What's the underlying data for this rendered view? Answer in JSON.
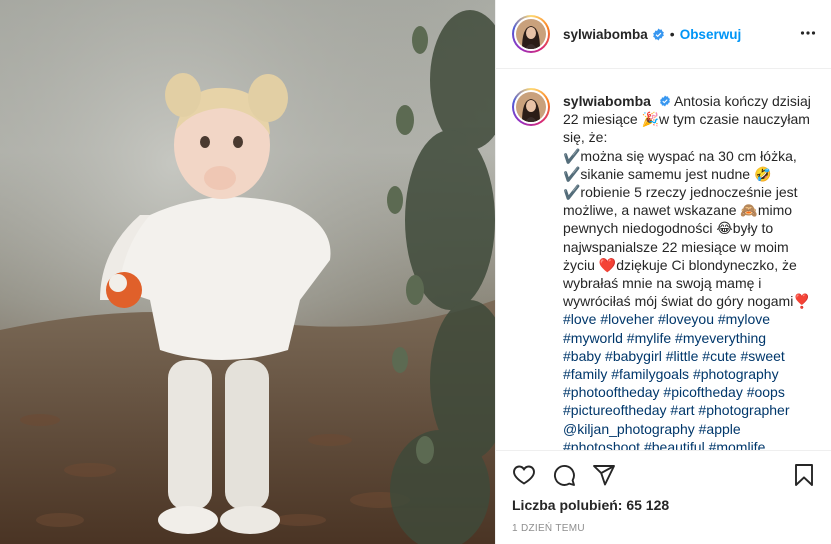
{
  "post": {
    "username": "sylwiabomba",
    "follow_label": "Obserwuj",
    "separator": "•",
    "caption": {
      "username": "sylwiabomba",
      "lines": [
        "Antosia kończy dzisiaj",
        "22 miesiące 🎉w tym czasie nauczyłam",
        "się, że:",
        "✔️można się wyspać na 30 cm łóżka,",
        "✔️sikanie samemu jest nudne 🤣",
        "✔️robienie 5 rzeczy jednocześnie jest",
        "możliwe, a nawet wskazane 🙈mimo",
        "pewnych niedogodności 😂były to",
        "najwspanialsze 22 miesiące w moim",
        "życiu ❤️dziękuje Ci blondyneczko, że",
        "wybrałaś mnie na swoją mamę i",
        "wywróciłaś mój świat do góry nogami❣️"
      ],
      "hashtag_lines": [
        "#love #loveher #loveyou #mylove",
        "#myworld #mylife #myeverything",
        "#baby #babygirl #little #cute #sweet",
        "#family #familygoals #photography",
        "#photooftheday #picoftheday #oops",
        "#pictureoftheday #art #photographer",
        "@kiljan_photography #apple",
        "#photoshoot #beautiful #momlife"
      ]
    },
    "likes_label": "Liczba polubień:",
    "likes_count": "65 128",
    "timestamp": "1 DZIEŃ TEMU"
  },
  "icons": {
    "verified": "verified-badge-icon",
    "more": "more-options-icon",
    "like": "heart-icon",
    "comment": "comment-icon",
    "share": "share-icon",
    "save": "bookmark-icon"
  },
  "colors": {
    "follow": "#0095f6",
    "hashtag": "#00376b",
    "verified": "#3897f0",
    "border": "#efefef",
    "muted": "#8e8e8e"
  }
}
